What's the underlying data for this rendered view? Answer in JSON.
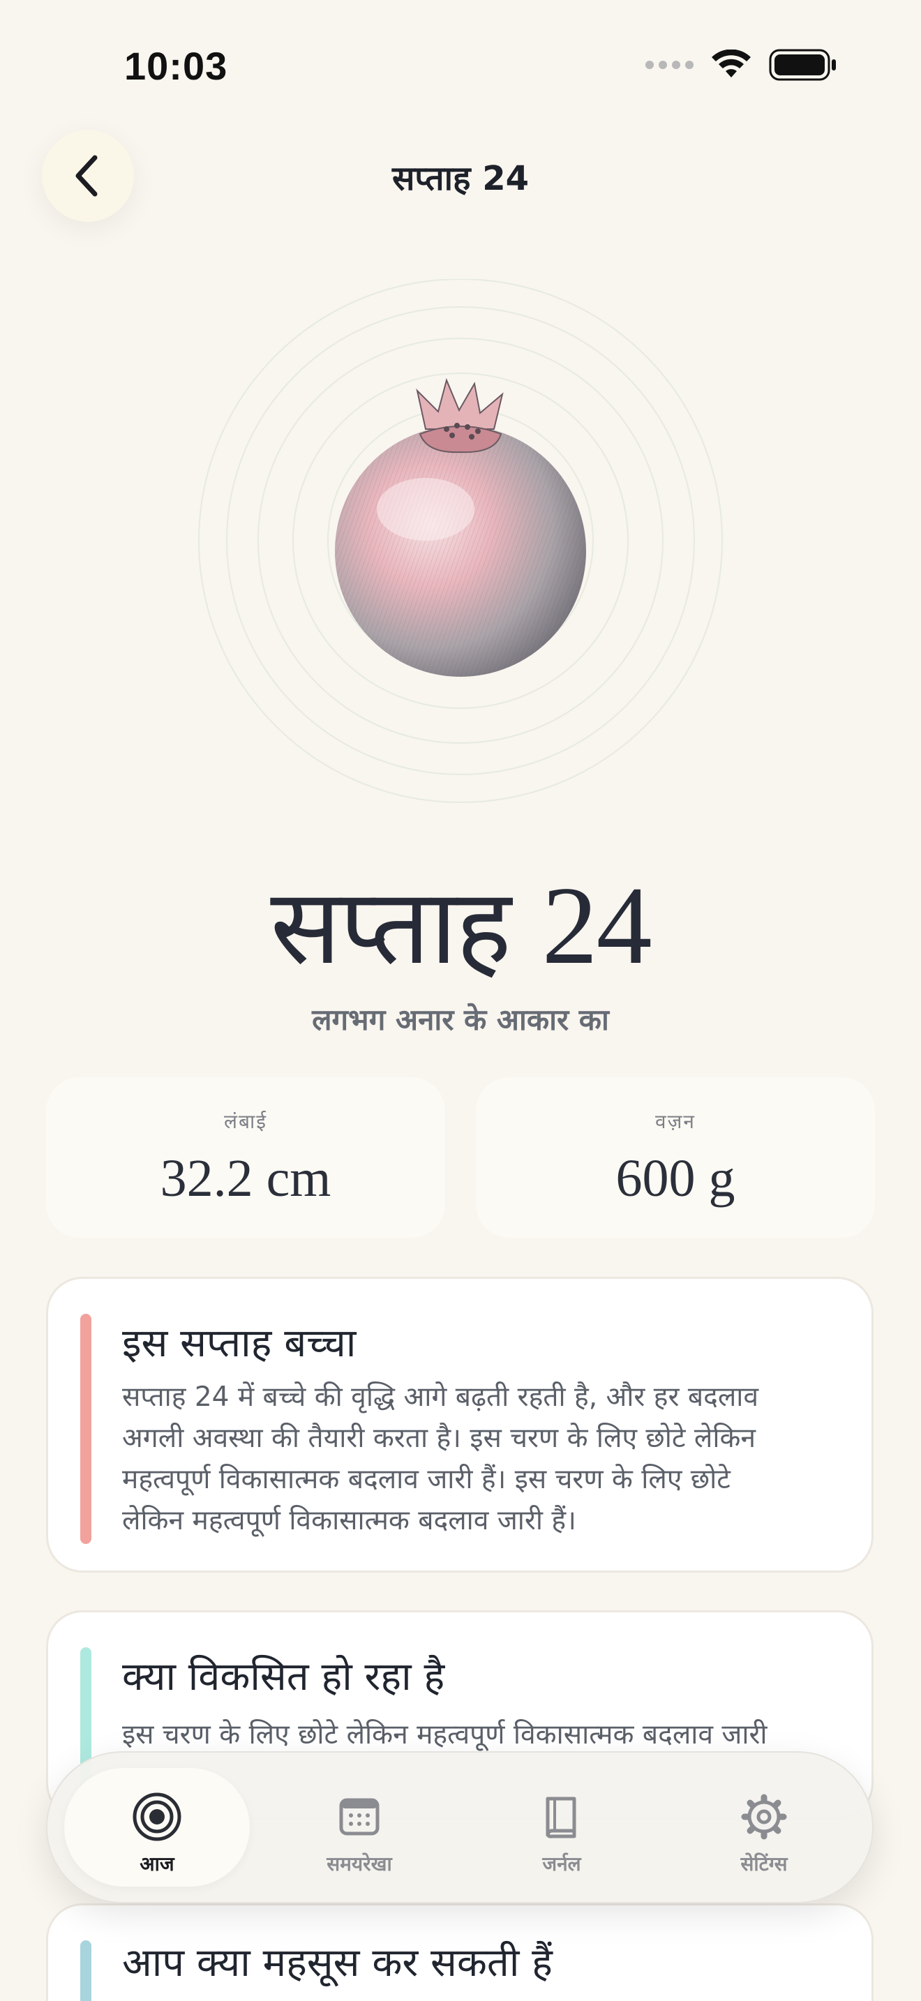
{
  "status_bar": {
    "time": "10:03"
  },
  "header": {
    "title": "सप्ताह 24"
  },
  "hero": {
    "title_word": "सप्ताह",
    "title_number": "24",
    "subtitle": "लगभग अनार के आकार का",
    "fruit_icon": "pomegranate-illustration"
  },
  "stats": [
    {
      "label": "लंबाई",
      "value": "32.2 cm"
    },
    {
      "label": "वज़न",
      "value": "600 g"
    }
  ],
  "cards": [
    {
      "title": "इस सप्ताह बच्चा",
      "body_lines": [
        "सप्ताह 24 में बच्चे की वृद्धि आगे बढ़ती रहती है, और हर बदलाव",
        "अगली अवस्था की तैयारी करता है। इस चरण के लिए छोटे लेकिन",
        "महत्वपूर्ण विकासात्मक बदलाव जारी हैं। इस चरण के लिए छोटे",
        "लेकिन महत्वपूर्ण विकासात्मक बदलाव जारी हैं।"
      ],
      "accent": "#f2a29c"
    },
    {
      "title": "क्या विकसित हो रहा है",
      "body": "इस चरण के लिए छोटे लेकिन महत्वपूर्ण विकासात्मक बदलाव जारी",
      "accent": "#aee9df"
    },
    {
      "title": "आप क्या महसूस कर सकती हैं",
      "accent": "#a8d4de"
    }
  ],
  "tabs": [
    {
      "label": "आज",
      "icon": "target-icon",
      "active": true
    },
    {
      "label": "समयरेखा",
      "icon": "calendar-icon",
      "active": false
    },
    {
      "label": "जर्नल",
      "icon": "book-icon",
      "active": false
    },
    {
      "label": "सेटिंग्स",
      "icon": "gear-icon",
      "active": false
    }
  ]
}
